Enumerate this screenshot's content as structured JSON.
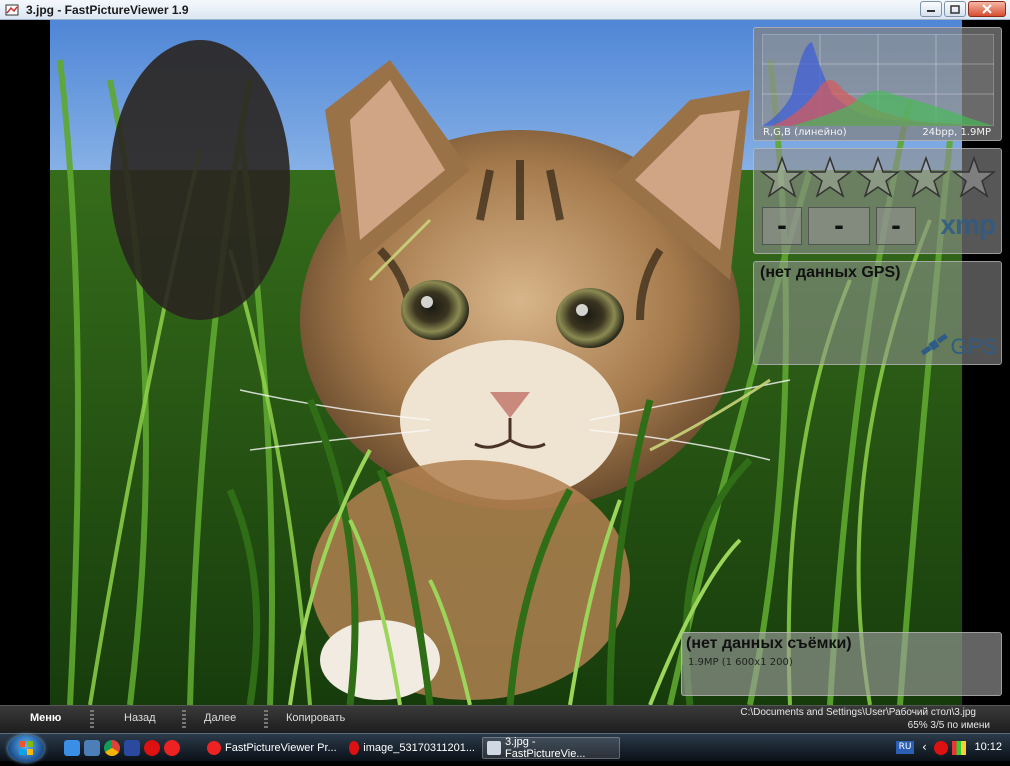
{
  "window": {
    "title": "3.jpg - FastPictureViewer 1.9",
    "app_icon": "fastpictureviewer-icon",
    "buttons": [
      "minimize-icon",
      "maximize-icon",
      "close-icon"
    ]
  },
  "overlays": {
    "histogram": {
      "channel_label": "R,G,B (линейно)",
      "info_label": "24bpp, 1.9MP",
      "colors": {
        "blue": "#3b5bd8",
        "red": "#d85a5a",
        "green": "#49b85a"
      }
    },
    "rating": {
      "stars": [
        "star-icon",
        "star-icon",
        "star-icon",
        "star-icon",
        "star-icon"
      ],
      "fields": [
        "-",
        "-",
        "-"
      ],
      "xmp_label": "xmp"
    },
    "gps": {
      "message": "(нет данных GPS)",
      "logo_label": "GPS",
      "icon": "satellite-icon"
    },
    "shooting": {
      "message": "(нет данных съёмки)",
      "size_info": "1.9MP (1 600x1 200)"
    }
  },
  "appbar": {
    "menu": "Меню",
    "back": "Назад",
    "next": "Далее",
    "copy": "Копировать",
    "path": "C:\\Documents and Settings\\User\\Рабочий стол\\3.jpg",
    "zoom_info": "65%  3/5  по имени"
  },
  "taskbar": {
    "start_icon": "windows-start-icon",
    "quick_launch": [
      "ie-icon",
      "desktop-icon",
      "chrome-icon",
      "save-icon",
      "opera-icon",
      "yandex-icon"
    ],
    "items": [
      {
        "label": "FastPictureViewer Pr...",
        "icon": "yandex-icon",
        "active": false
      },
      {
        "label": "image_53170311201...",
        "icon": "opera-icon",
        "active": false
      },
      {
        "label": "3.jpg - FastPictureVie...",
        "icon": "fastpictureviewer-icon",
        "active": true
      }
    ],
    "tray": {
      "lang": "RU",
      "clock": "10:12"
    }
  },
  "colors": {
    "sky": "#6f9ad8",
    "grass_dark": "#1f4a12",
    "grass_light": "#7fbf3a",
    "cat_fur": "#b58a57"
  }
}
